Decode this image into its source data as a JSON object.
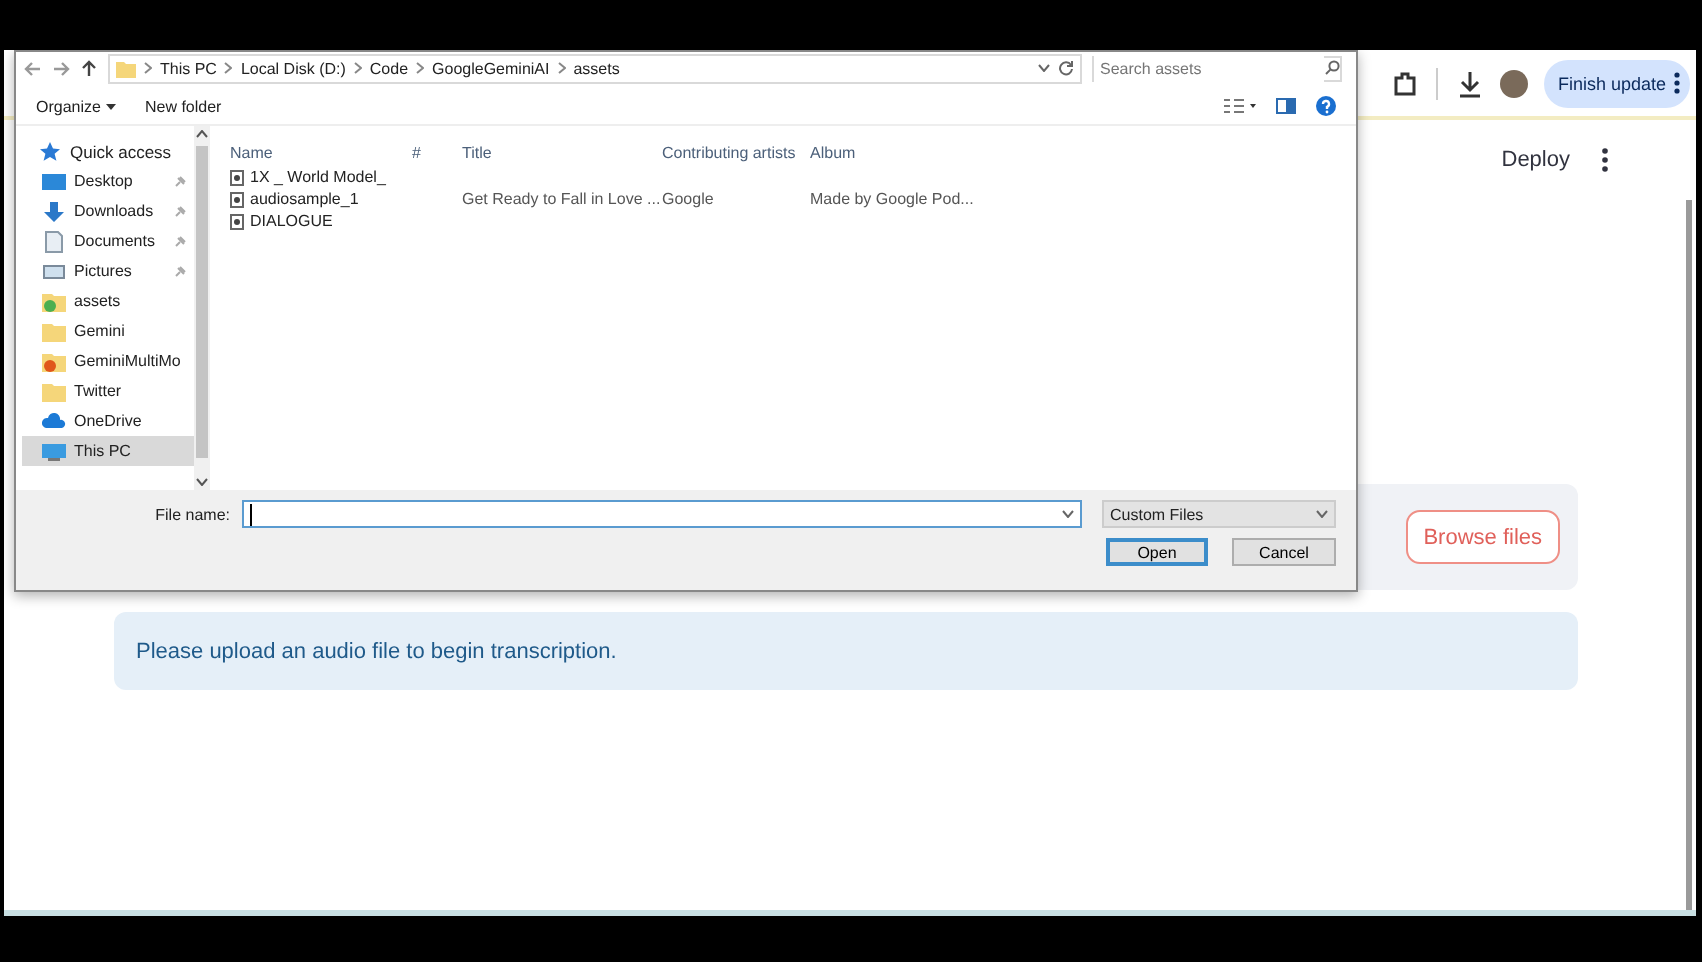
{
  "browser": {
    "update_button": "Finish update"
  },
  "app": {
    "deploy": "Deploy",
    "uploader": {
      "button": "Browse files"
    },
    "info": "Please upload an audio file to begin transcription."
  },
  "dialog": {
    "breadcrumb": [
      "This PC",
      "Local Disk (D:)",
      "Code",
      "GoogleGeminiAI",
      "assets"
    ],
    "search": {
      "placeholder": "Search assets"
    },
    "organize": "Organize",
    "new_folder": "New folder",
    "nav": [
      {
        "label": "Quick access",
        "kind": "star",
        "pinned": false,
        "selected": false
      },
      {
        "label": "Desktop",
        "kind": "desktop",
        "pinned": true,
        "selected": false
      },
      {
        "label": "Downloads",
        "kind": "download",
        "pinned": true,
        "selected": false
      },
      {
        "label": "Documents",
        "kind": "document",
        "pinned": true,
        "selected": false
      },
      {
        "label": "Pictures",
        "kind": "picture",
        "pinned": true,
        "selected": false
      },
      {
        "label": "assets",
        "kind": "folder_check",
        "pinned": false,
        "selected": false
      },
      {
        "label": "Gemini",
        "kind": "folder",
        "pinned": false,
        "selected": false
      },
      {
        "label": "GeminiMultiMo",
        "kind": "folder_app",
        "pinned": false,
        "selected": false
      },
      {
        "label": "Twitter",
        "kind": "folder",
        "pinned": false,
        "selected": false
      },
      {
        "label": "OneDrive",
        "kind": "cloud",
        "pinned": false,
        "selected": false
      },
      {
        "label": "This PC",
        "kind": "pc",
        "pinned": false,
        "selected": true
      }
    ],
    "columns": [
      "Name",
      "#",
      "Title",
      "Contributing artists",
      "Album"
    ],
    "files": [
      {
        "name": "1X _ World Model_"
      },
      {
        "name": "audiosample_1",
        "title": "Get Ready to Fall in Love ...",
        "artist": "Google",
        "album": "Made by Google Pod..."
      },
      {
        "name": "DIALOGUE"
      }
    ],
    "file_name_label": "File name:",
    "filter": "Custom Files",
    "buttons": [
      "Open",
      "Cancel"
    ]
  }
}
